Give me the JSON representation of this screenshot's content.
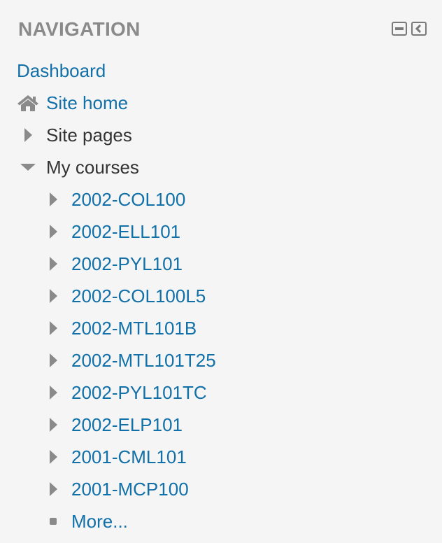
{
  "navigation": {
    "title": "NAVIGATION",
    "controls": {
      "hide_icon": "minus-square-icon",
      "dock_icon": "dock-left-icon"
    },
    "dashboard": {
      "label": "Dashboard"
    },
    "site_home": {
      "label": "Site home",
      "icon": "home-icon"
    },
    "site_pages": {
      "label": "Site pages",
      "icon": "caret-right-icon"
    },
    "my_courses": {
      "label": "My courses",
      "icon": "caret-down-icon",
      "courses": [
        {
          "label": "2002-COL100"
        },
        {
          "label": "2002-ELL101"
        },
        {
          "label": "2002-PYL101"
        },
        {
          "label": "2002-COL100L5"
        },
        {
          "label": "2002-MTL101B"
        },
        {
          "label": "2002-MTL101T25"
        },
        {
          "label": "2002-PYL101TC"
        },
        {
          "label": "2002-ELP101"
        },
        {
          "label": "2001-CML101"
        },
        {
          "label": "2001-MCP100"
        }
      ],
      "more": {
        "label": "More...",
        "icon": "square-bullet-icon"
      }
    }
  },
  "colors": {
    "background": "#f5f5f5",
    "title": "#8a8a8a",
    "link": "#1270a8",
    "text": "#333333",
    "icon": "#8a8a8a"
  }
}
